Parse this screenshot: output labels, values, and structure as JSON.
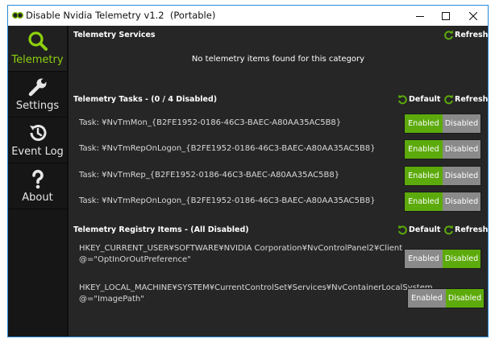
{
  "window": {
    "title": "Disable Nvidia Telemetry v1.2  (Portable)",
    "controls": [
      "minimize",
      "maximize",
      "close"
    ]
  },
  "sidebar": {
    "items": [
      {
        "label": "Telemetry",
        "icon": "search-icon",
        "active": true
      },
      {
        "label": "Settings",
        "icon": "wrench-icon",
        "active": false
      },
      {
        "label": "Event Log",
        "icon": "history-icon",
        "active": false
      },
      {
        "label": "About",
        "icon": "question-icon",
        "active": false
      }
    ]
  },
  "services": {
    "title": "Telemetry Services",
    "refresh_label": "Refresh",
    "empty_message": "No telemetry items found for this category"
  },
  "tasks": {
    "title": "Telemetry Tasks - (0 / 4 Disabled)",
    "default_label": "Default",
    "refresh_label": "Refresh",
    "enabled_label": "Enabled",
    "disabled_label": "Disabled",
    "items": [
      {
        "text": "Task: ¥NvTmMon_{B2FE1952-0186-46C3-BAEC-A80AA35AC5B8}",
        "state": "Enabled"
      },
      {
        "text": "Task: ¥NvTmRepOnLogon_{B2FE1952-0186-46C3-BAEC-A80AA35AC5B8}",
        "state": "Enabled"
      },
      {
        "text": "Task: ¥NvTmRep_{B2FE1952-0186-46C3-BAEC-A80AA35AC5B8}",
        "state": "Enabled"
      },
      {
        "text": "Task: ¥NvTmRepOnLogon_{B2FE1952-0186-46C3-BAEC-A80AA35AC5B8}",
        "state": "Enabled"
      }
    ]
  },
  "registry": {
    "title": "Telemetry Registry Items - (All Disabled)",
    "default_label": "Default",
    "refresh_label": "Refresh",
    "enabled_label": "Enabled",
    "disabled_label": "Disabled",
    "items": [
      {
        "line1": "HKEY_CURRENT_USER¥SOFTWARE¥NVIDIA Corporation¥NvControlPanel2¥Client",
        "line2": "@=\"OptInOrOutPreference\"",
        "state": "Disabled"
      },
      {
        "line1": "HKEY_LOCAL_MACHINE¥SYSTEM¥CurrentControlSet¥Services¥NvContainerLocalSystem",
        "line2": "@=\"ImagePath\"",
        "state": "Disabled"
      }
    ]
  },
  "colors": {
    "accent_green": "#5caa0b",
    "active_nav_label": "#8dd10e",
    "inactive_gray": "#8a8a8a",
    "background": "#262626"
  }
}
